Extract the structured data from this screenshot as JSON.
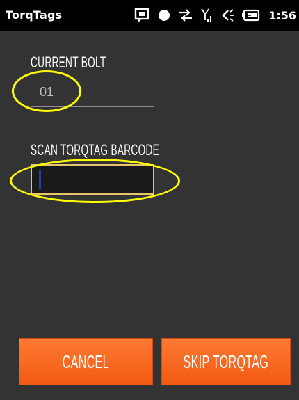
{
  "status_bar": {
    "app_title": "TorqTags",
    "time": "1:56",
    "icons": [
      "message-icon",
      "record-icon",
      "sync-icon",
      "signal-icon",
      "speaker-icon",
      "battery-icon"
    ]
  },
  "form": {
    "current_bolt_label": "CURRENT BOLT",
    "current_bolt_value": "01",
    "scan_label": "SCAN TORQTAG BARCODE",
    "scan_value": ""
  },
  "buttons": {
    "cancel_label": "CANCEL",
    "skip_label": "SKIP TORQTAG"
  },
  "colors": {
    "background": "#333333",
    "status_bar": "#000000",
    "button_orange": "#f4621a",
    "annotation": "#ffff00",
    "focus_border": "#e8c46a"
  }
}
